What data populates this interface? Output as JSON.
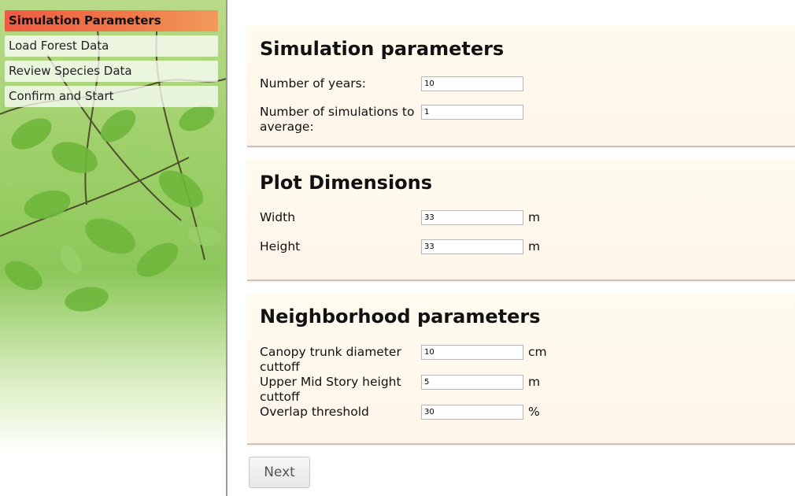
{
  "nav": {
    "items": [
      {
        "label": "Simulation Parameters"
      },
      {
        "label": "Load Forest Data"
      },
      {
        "label": "Review Species Data"
      },
      {
        "label": "Confirm and Start"
      }
    ]
  },
  "simulation": {
    "title": "Simulation parameters",
    "years_label": "Number of years:",
    "years_value": "10",
    "sims_label": "Number of simulations to average:",
    "sims_value": "1"
  },
  "plot": {
    "title": "Plot Dimensions",
    "width_label": "Width",
    "width_value": "33",
    "width_unit": "m",
    "height_label": "Height",
    "height_value": "33",
    "height_unit": "m"
  },
  "neighborhood": {
    "title": "Neighborhood parameters",
    "canopy_label": "Canopy trunk diameter cuttoff",
    "canopy_value": "10",
    "canopy_unit": "cm",
    "upper_label": "Upper Mid Story height cuttoff",
    "upper_value": "5",
    "upper_unit": "m",
    "overlap_label": "Overlap threshold",
    "overlap_value": "30",
    "overlap_unit": "%"
  },
  "actions": {
    "next_label": "Next"
  },
  "colors": {
    "active_nav": "#ef5b43",
    "panel_bg": "#fffbef"
  }
}
